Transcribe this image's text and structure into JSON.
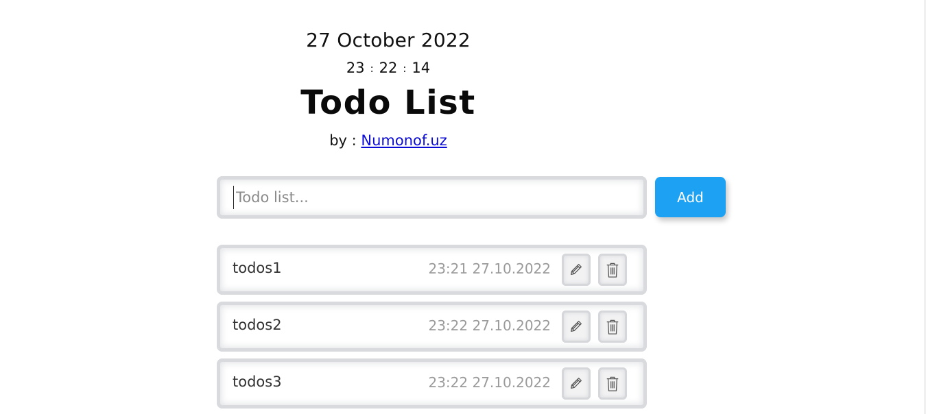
{
  "header": {
    "date": "27 October 2022",
    "time": {
      "hours": "23",
      "minutes": "22",
      "seconds": "14",
      "separator": ":"
    },
    "title": "Todo List",
    "byline_prefix": "by : ",
    "author_link": "Numonof.uz"
  },
  "form": {
    "input_placeholder": "Todo list...",
    "input_value": "",
    "add_label": "Add"
  },
  "todos": [
    {
      "text": "todos1",
      "time": "23:21 27.10.2022"
    },
    {
      "text": "todos2",
      "time": "23:22 27.10.2022"
    },
    {
      "text": "todos3",
      "time": "23:22 27.10.2022"
    }
  ],
  "icons": {
    "edit": "pencil-icon",
    "delete": "trash-icon"
  },
  "colors": {
    "accent": "#1da1f2",
    "link": "#0b0bd6",
    "muted_text": "#9a9a9a"
  }
}
